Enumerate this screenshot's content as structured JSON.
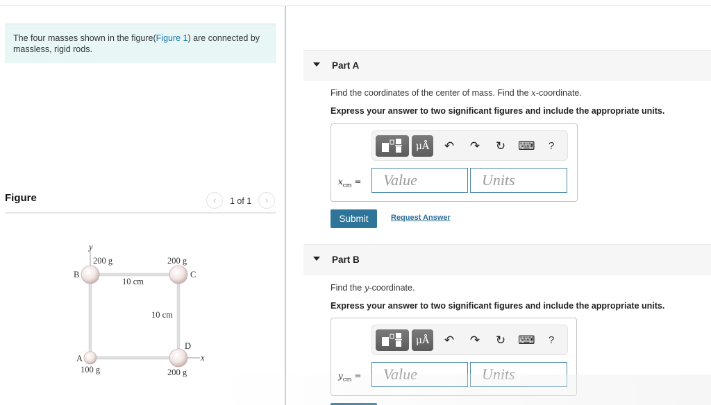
{
  "intro": {
    "text_before": "The four masses shown in the figure(",
    "link": "Figure 1",
    "text_after": ") are connected by massless, rigid rods."
  },
  "figure": {
    "title": "Figure",
    "pager": {
      "prev_icon": "‹",
      "text": "1 of 1",
      "next_icon": "›"
    },
    "diagram": {
      "axis_x": "x",
      "axis_y": "y",
      "masses": [
        {
          "label": "A",
          "mass": "100 g"
        },
        {
          "label": "B",
          "mass": "200 g"
        },
        {
          "label": "C",
          "mass": "200 g"
        },
        {
          "label": "D",
          "mass": "200 g"
        }
      ],
      "dims": {
        "horizontal": "10 cm",
        "vertical": "10 cm"
      }
    }
  },
  "partA": {
    "title": "Part A",
    "prompt_before": "Find the coordinates of the center of mass. Find the ",
    "prompt_var": "x",
    "prompt_after": "-coordinate.",
    "instruction": "Express your answer to two significant figures and include the appropriate units.",
    "eq_var": "x",
    "eq_sub": "cm",
    "eq_sign": " =",
    "value_placeholder": "Value",
    "units_placeholder": "Units",
    "submit": "Submit",
    "request": "Request Answer"
  },
  "partB": {
    "title": "Part B",
    "prompt_before": "Find the ",
    "prompt_var": "y",
    "prompt_after": "-coordinate.",
    "instruction": "Express your answer to two significant figures and include the appropriate units.",
    "eq_var": "y",
    "eq_sub": "cm",
    "eq_sign": " =",
    "value_placeholder": "Value",
    "units_placeholder": "Units"
  },
  "toolbar": {
    "units_label": "μÅ",
    "undo": "↶",
    "redo": "↷",
    "reset": "↻",
    "keyboard": "⌨",
    "help": "?"
  }
}
